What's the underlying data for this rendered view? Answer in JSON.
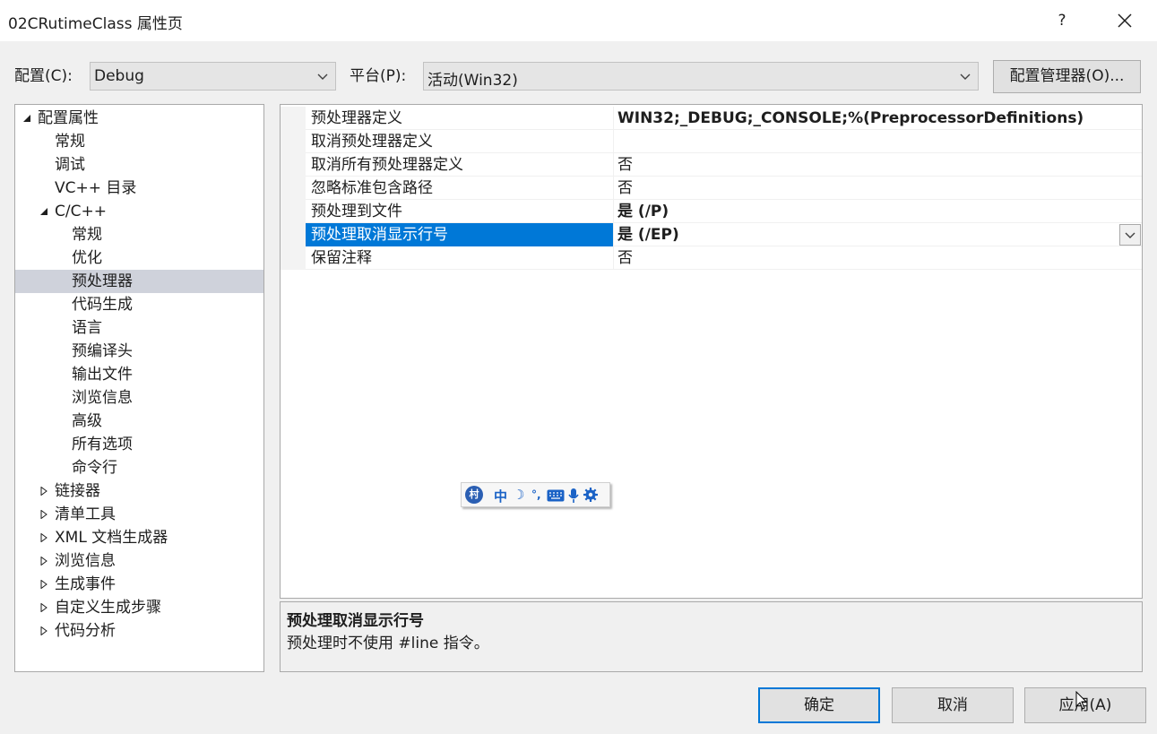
{
  "window": {
    "title": "02CRutimeClass 属性页",
    "help_label": "?"
  },
  "toolbar": {
    "config_label": "配置(C):",
    "config_value": "Debug",
    "platform_label": "平台(P):",
    "platform_value": "活动(Win32)",
    "config_manager_label": "配置管理器(O)..."
  },
  "tree": {
    "items": [
      {
        "label": "配置属性",
        "expander": "expanded"
      },
      {
        "label": "常规",
        "expander": ""
      },
      {
        "label": "调试",
        "expander": ""
      },
      {
        "label": "VC++ 目录",
        "expander": ""
      },
      {
        "label": "C/C++",
        "expander": "expanded"
      },
      {
        "label": "常规",
        "expander": ""
      },
      {
        "label": "优化",
        "expander": ""
      },
      {
        "label": "预处理器",
        "expander": "",
        "selected": true
      },
      {
        "label": "代码生成",
        "expander": ""
      },
      {
        "label": "语言",
        "expander": ""
      },
      {
        "label": "预编译头",
        "expander": ""
      },
      {
        "label": "输出文件",
        "expander": ""
      },
      {
        "label": "浏览信息",
        "expander": ""
      },
      {
        "label": "高级",
        "expander": ""
      },
      {
        "label": "所有选项",
        "expander": ""
      },
      {
        "label": "命令行",
        "expander": ""
      },
      {
        "label": "链接器",
        "expander": "collapsed"
      },
      {
        "label": "清单工具",
        "expander": "collapsed"
      },
      {
        "label": "XML 文档生成器",
        "expander": "collapsed"
      },
      {
        "label": "浏览信息",
        "expander": "collapsed"
      },
      {
        "label": "生成事件",
        "expander": "collapsed"
      },
      {
        "label": "自定义生成步骤",
        "expander": "collapsed"
      },
      {
        "label": "代码分析",
        "expander": "collapsed"
      }
    ]
  },
  "properties": {
    "rows": [
      {
        "name": "预处理器定义",
        "value": "WIN32;_DEBUG;_CONSOLE;%(PreprocessorDefinitions)",
        "bold": true
      },
      {
        "name": "取消预处理器定义",
        "value": "",
        "bold": false
      },
      {
        "name": "取消所有预处理器定义",
        "value": "否",
        "bold": false
      },
      {
        "name": "忽略标准包含路径",
        "value": "否",
        "bold": false
      },
      {
        "name": "预处理到文件",
        "value": "是 (/P)",
        "bold": true
      },
      {
        "name": "预处理取消显示行号",
        "value": "是 (/EP)",
        "bold": true,
        "selected": true
      },
      {
        "name": "保留注释",
        "value": "否",
        "bold": false
      }
    ]
  },
  "description": {
    "title": "预处理取消显示行号",
    "text": "预处理时不使用 #line 指令。"
  },
  "ime_toolbar": {
    "logo": "村",
    "mode": "中",
    "moon": "☽",
    "punct": "°,"
  },
  "buttons": {
    "ok": "确定",
    "cancel": "取消",
    "apply": "应用(A)"
  },
  "colors": {
    "selection": "#0078d7",
    "tree_selection": "#cfd2db"
  }
}
